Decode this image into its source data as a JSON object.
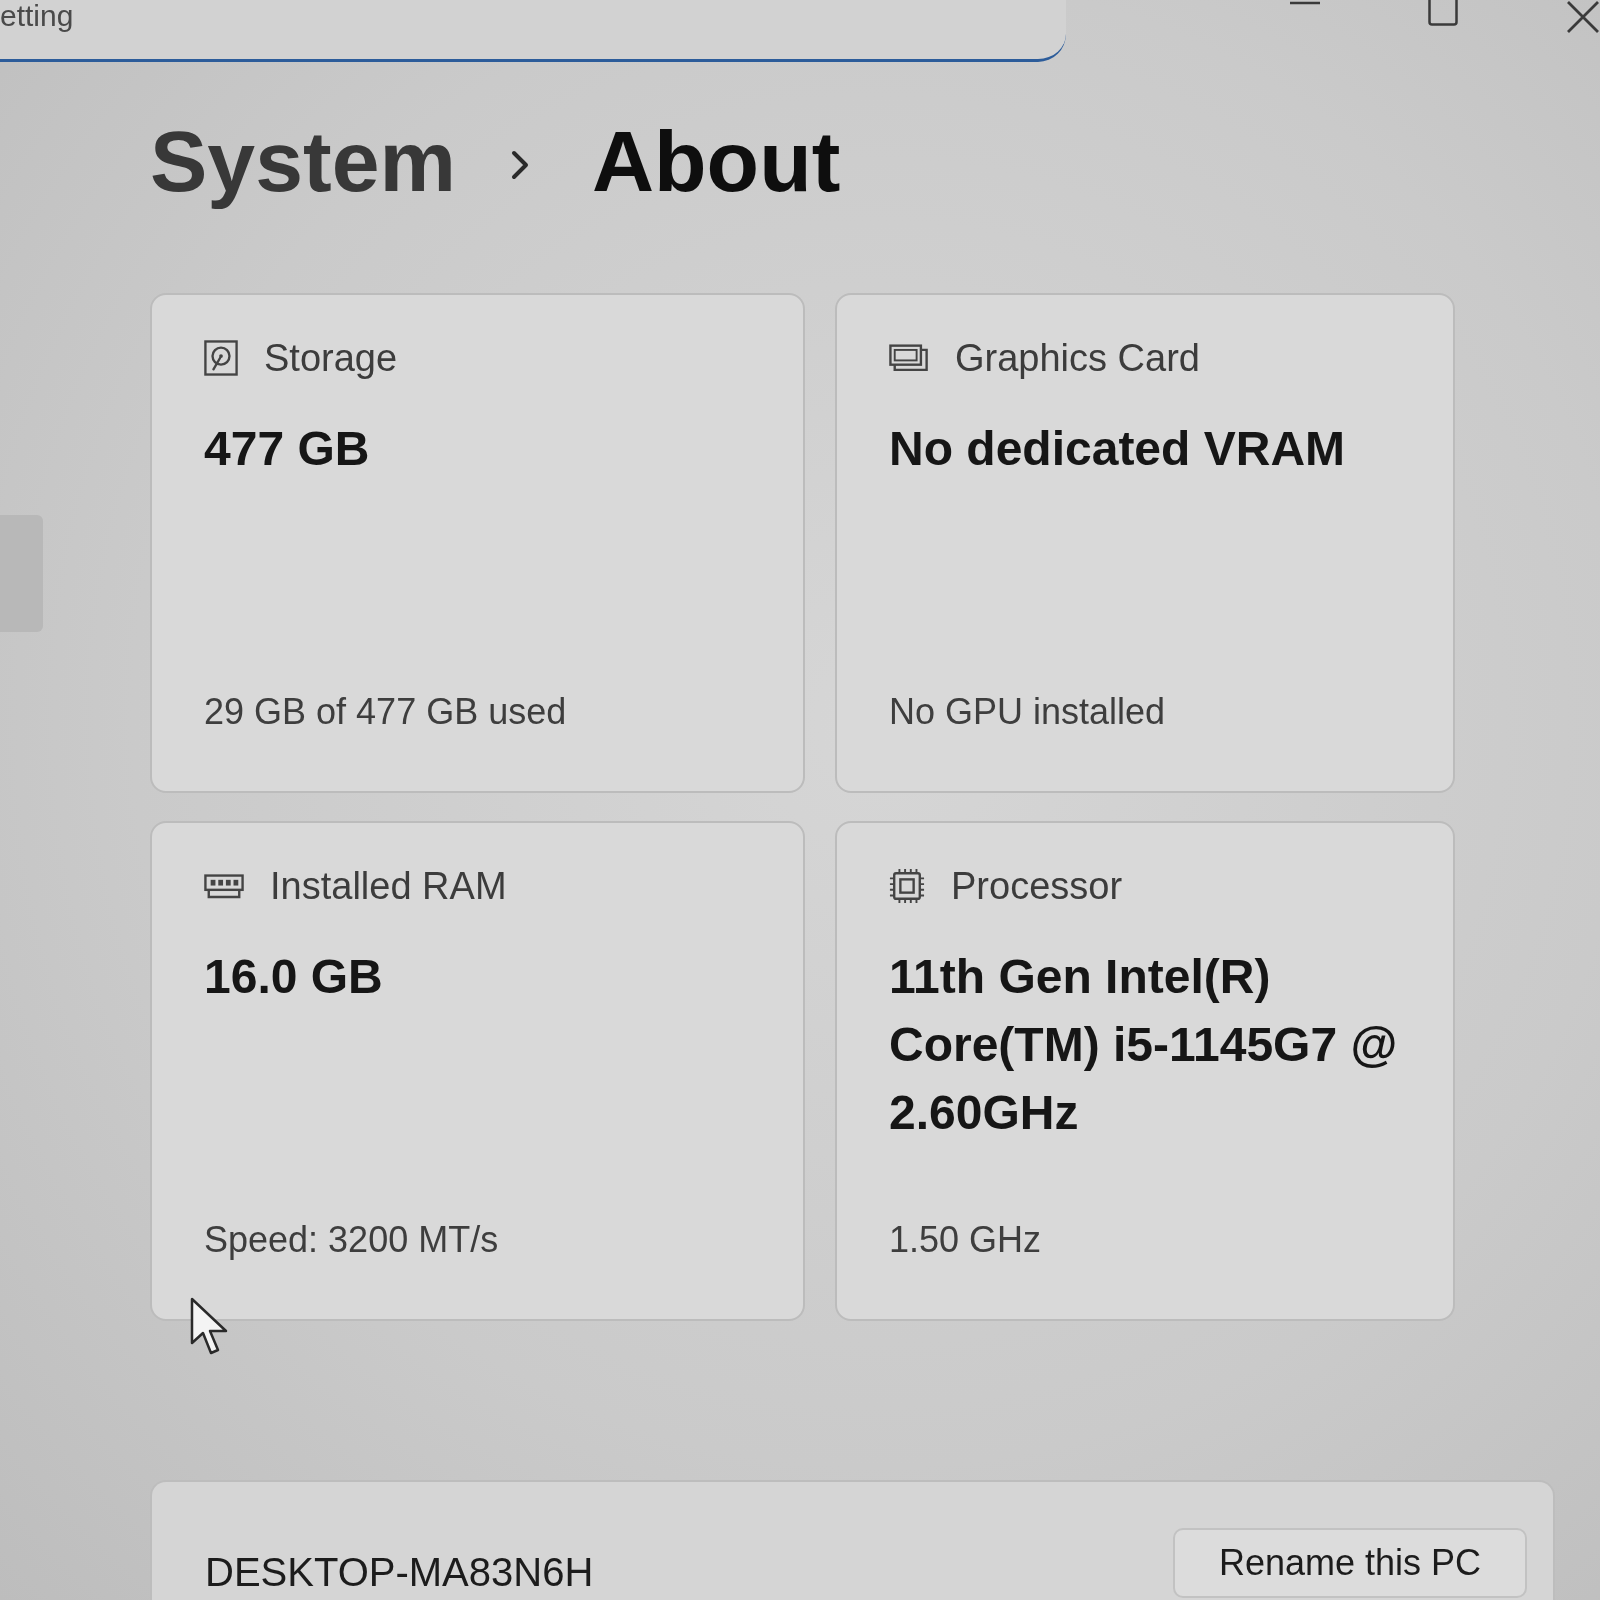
{
  "search": {
    "placeholder": "etting"
  },
  "breadcrumb": [
    {
      "label": "System",
      "current": false
    },
    {
      "label": "About",
      "current": true
    }
  ],
  "cards": [
    {
      "kind": "storage",
      "title": "Storage",
      "value": "477 GB",
      "detail": "29 GB of 477 GB used"
    },
    {
      "kind": "graphics",
      "title": "Graphics Card",
      "value": "No dedicated VRAM",
      "detail": "No GPU installed"
    },
    {
      "kind": "memory",
      "title": "Installed RAM",
      "value": "16.0 GB",
      "detail": "Speed: 3200 MT/s"
    },
    {
      "kind": "processor",
      "title": "Processor",
      "value": "11th Gen Intel(R) Core(TM) i5-1145G7 @ 2.60GHz",
      "detail": "1.50 GHz"
    }
  ],
  "device": {
    "name": "DESKTOP-MA83N6H",
    "rename_button": "Rename this PC"
  }
}
